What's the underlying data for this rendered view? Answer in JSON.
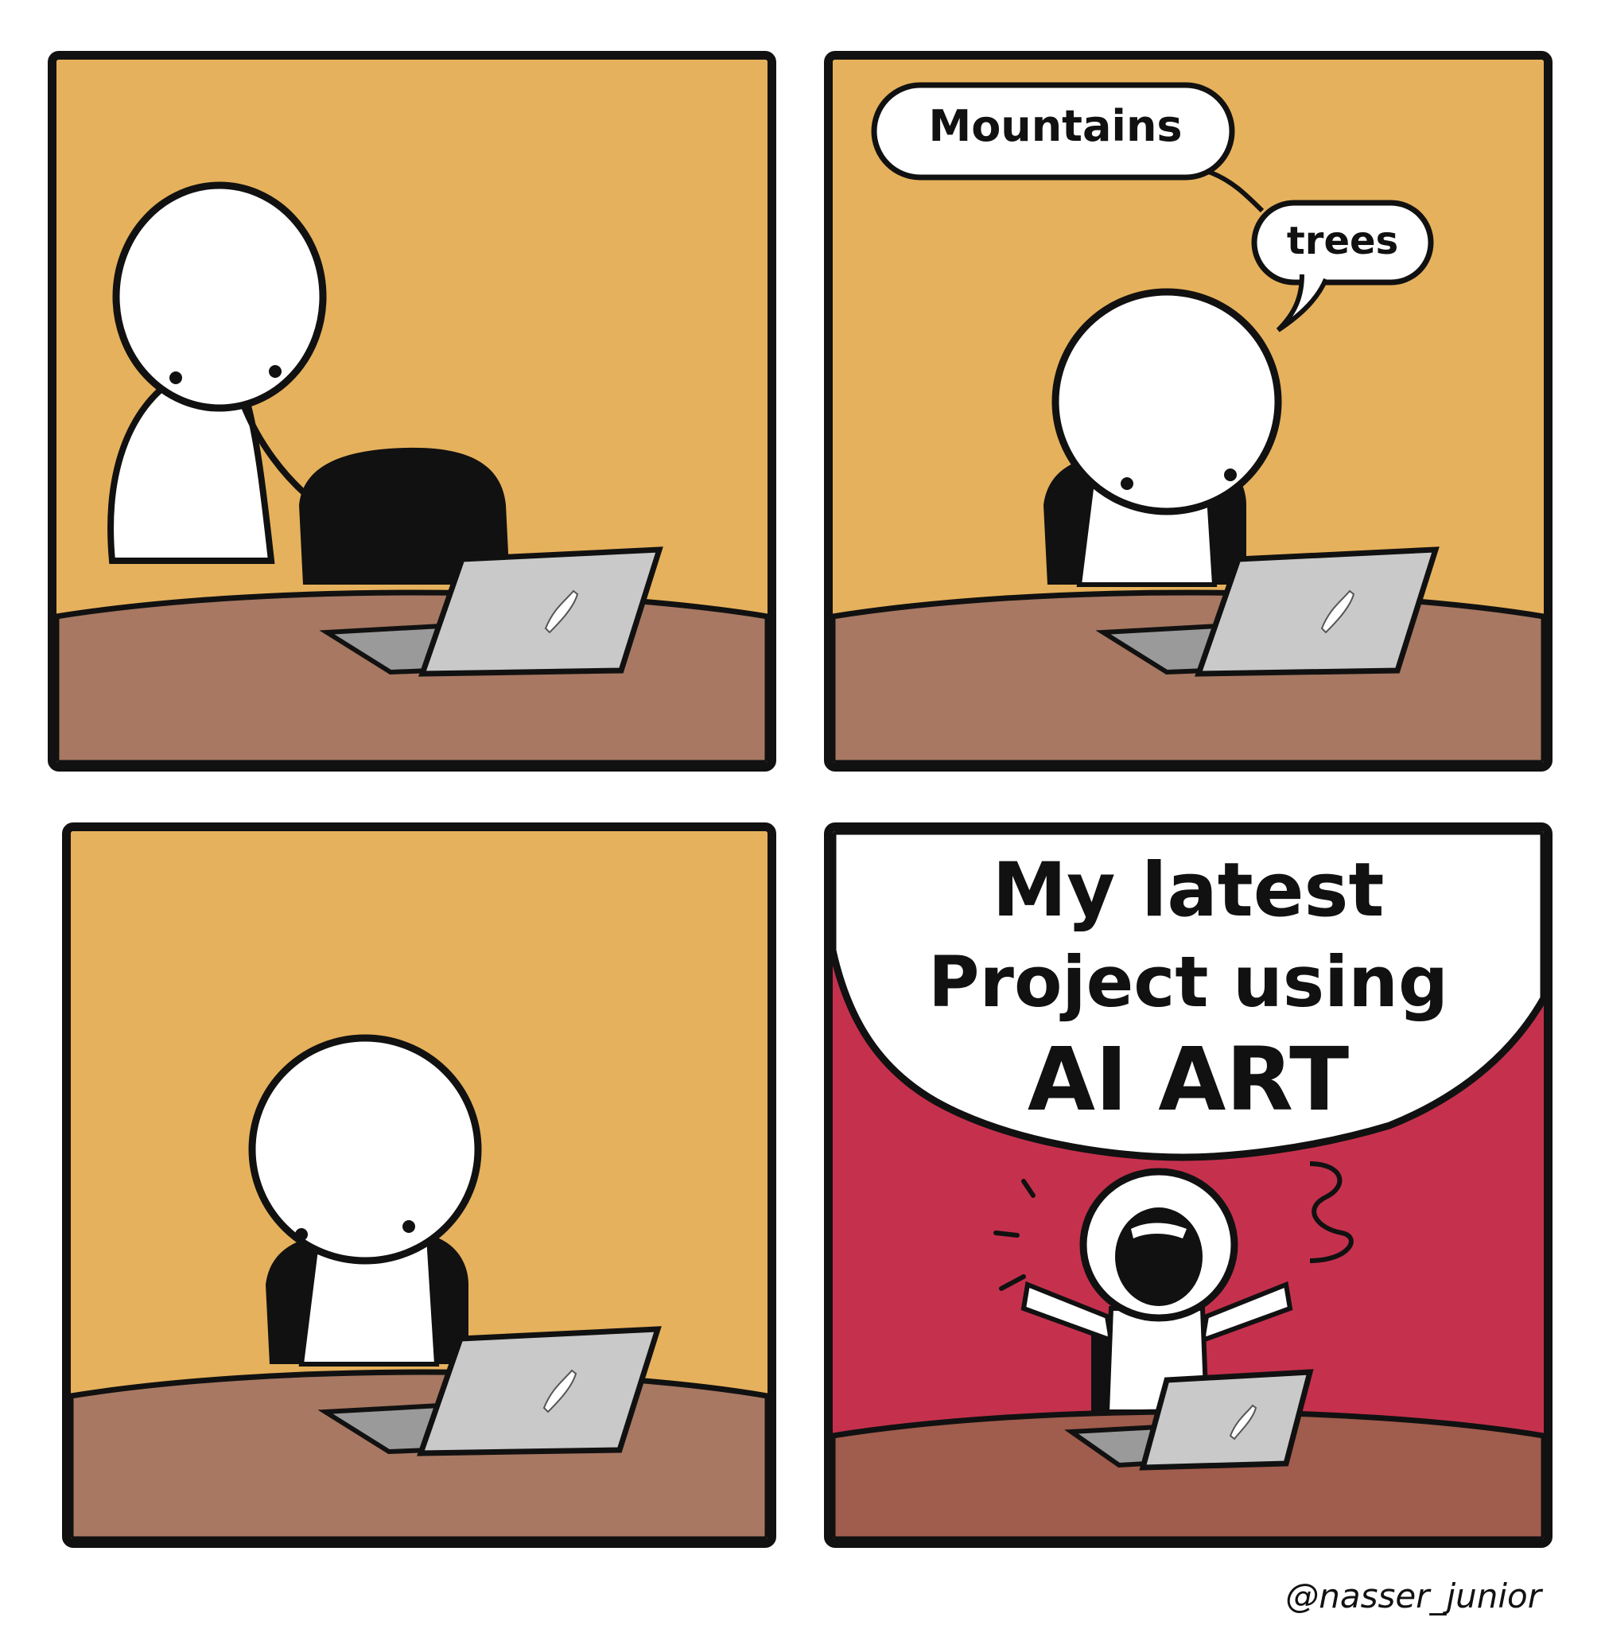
{
  "comic": {
    "panel2": {
      "bubble1": "Mountains",
      "bubble2": "trees"
    },
    "panel4": {
      "line1": "My latest",
      "line2": "Project using",
      "line3": "AI ART"
    },
    "credit": "@nasser_junior"
  },
  "colors": {
    "wall": "#E6B15C",
    "table": "#A87862",
    "shout_bg": "#C5314D",
    "shout_table": "#A05C4C",
    "laptop": "#C9C9C9",
    "outline": "#111111"
  },
  "icons": {
    "laptop_logo": "carrot-icon"
  }
}
